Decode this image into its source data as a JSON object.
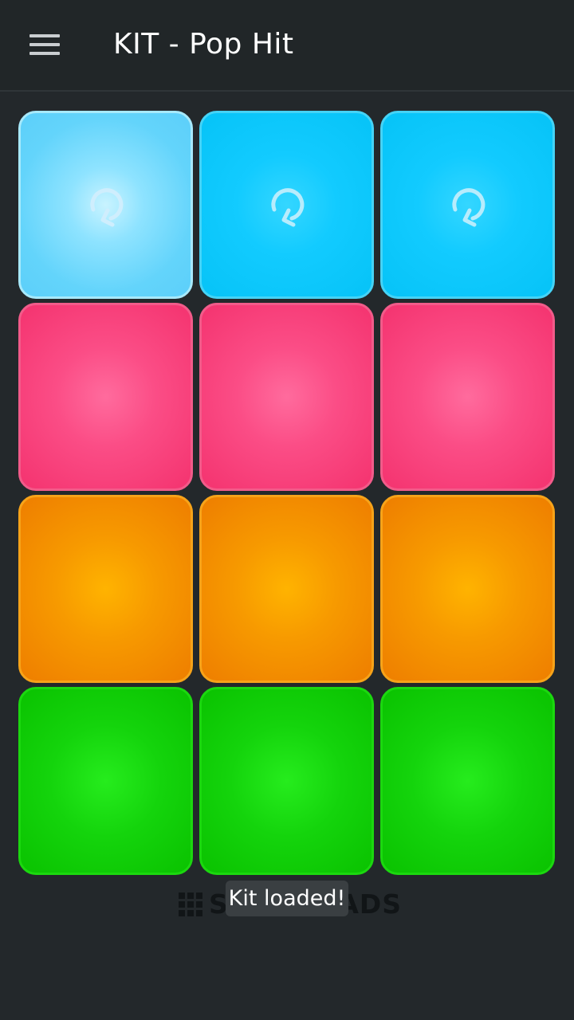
{
  "app_bar": {
    "title": "KIT - Pop Hit",
    "menu_icon": "hamburger-menu-icon"
  },
  "pads": {
    "rows": [
      [
        {
          "color": "#8ee3ff",
          "icon": "loop-icon"
        },
        {
          "color": "#12cbff",
          "icon": "loop-icon"
        },
        {
          "color": "#12cbff",
          "icon": "loop-icon"
        }
      ],
      [
        {
          "color": "#fb4d86"
        },
        {
          "color": "#fb4d86"
        },
        {
          "color": "#fb4d86"
        }
      ],
      [
        {
          "color": "#f79a00"
        },
        {
          "color": "#f79a00"
        },
        {
          "color": "#f79a00"
        }
      ],
      [
        {
          "color": "#14d40c"
        },
        {
          "color": "#14d40c"
        },
        {
          "color": "#14d40c"
        }
      ]
    ]
  },
  "brand": {
    "icon": "grid-icon",
    "text": "SUPER PADS"
  },
  "toast": {
    "message": "Kit loaded!"
  }
}
